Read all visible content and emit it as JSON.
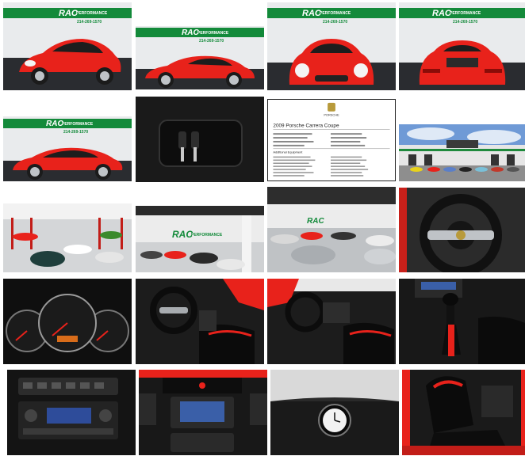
{
  "banner": {
    "brand": "RAC",
    "word": "PERFORMANCE",
    "phone": "214-269-1570"
  },
  "colors": {
    "car_red": "#e8221b",
    "banner_green": "#138a3a",
    "dark": "#141414",
    "floor": "#b8bcc0"
  },
  "sheet": {
    "brand": "PORSCHE",
    "title": "2009 Porsche Carrera Coupe",
    "section": "Additional Equipment"
  },
  "tiles": [
    {
      "name": "photo-car-front-three-quarter"
    },
    {
      "name": "photo-car-side-right"
    },
    {
      "name": "photo-car-front"
    },
    {
      "name": "photo-car-rear"
    },
    {
      "name": "photo-car-side-left"
    },
    {
      "name": "photo-keys-on-leather"
    },
    {
      "name": "photo-window-sticker"
    },
    {
      "name": "photo-dealership-building"
    },
    {
      "name": "photo-showroom-red-lifts"
    },
    {
      "name": "photo-showroom-sign"
    },
    {
      "name": "photo-showroom-floor"
    },
    {
      "name": "photo-steering-wheel"
    },
    {
      "name": "photo-gauge-cluster"
    },
    {
      "name": "photo-driver-interior"
    },
    {
      "name": "photo-passenger-interior"
    },
    {
      "name": "photo-shifter"
    },
    {
      "name": "photo-center-console-stereo"
    },
    {
      "name": "photo-dash-navigation"
    },
    {
      "name": "photo-dash-clock"
    },
    {
      "name": "photo-seat-side-view"
    }
  ]
}
